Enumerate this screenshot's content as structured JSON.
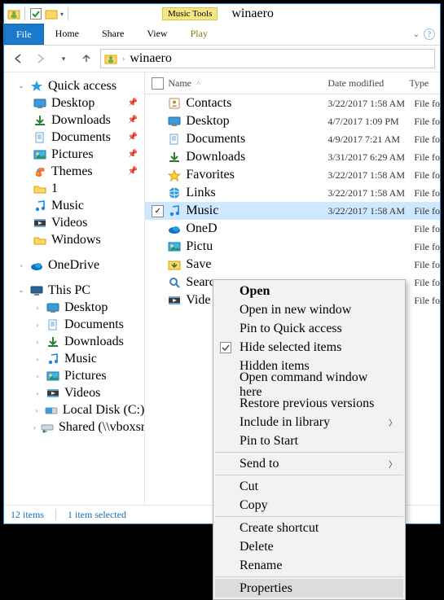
{
  "title": "winaero",
  "tools_tab": "Music Tools",
  "ribbon": {
    "file": "File",
    "tabs": [
      "Home",
      "Share",
      "View",
      "Play"
    ]
  },
  "address": {
    "segments": [
      "winaero"
    ]
  },
  "sidebar": {
    "quick_access": {
      "label": "Quick access",
      "items": [
        {
          "icon": "desktop",
          "label": "Desktop",
          "pinned": true
        },
        {
          "icon": "downloads",
          "label": "Downloads",
          "pinned": true
        },
        {
          "icon": "documents",
          "label": "Documents",
          "pinned": true
        },
        {
          "icon": "pictures",
          "label": "Pictures",
          "pinned": true
        },
        {
          "icon": "themes",
          "label": "Themes",
          "pinned": true
        },
        {
          "icon": "folder",
          "label": "1",
          "pinned": false
        },
        {
          "icon": "music",
          "label": "Music",
          "pinned": false
        },
        {
          "icon": "videos",
          "label": "Videos",
          "pinned": false
        },
        {
          "icon": "folder",
          "label": "Windows",
          "pinned": false
        }
      ]
    },
    "onedrive": {
      "label": "OneDrive"
    },
    "this_pc": {
      "label": "This PC",
      "items": [
        {
          "icon": "desktop",
          "label": "Desktop"
        },
        {
          "icon": "documents",
          "label": "Documents"
        },
        {
          "icon": "downloads",
          "label": "Downloads"
        },
        {
          "icon": "music",
          "label": "Music"
        },
        {
          "icon": "pictures",
          "label": "Pictures"
        },
        {
          "icon": "videos",
          "label": "Videos"
        },
        {
          "icon": "disk",
          "label": "Local Disk (C:)"
        },
        {
          "icon": "netdisk",
          "label": "Shared (\\\\vboxsr"
        }
      ]
    }
  },
  "columns": {
    "name": "Name",
    "date": "Date modified",
    "type": "Type"
  },
  "rows": [
    {
      "icon": "contacts",
      "name": "Contacts",
      "date": "3/22/2017 1:58 AM",
      "type": "File fo",
      "selected": false
    },
    {
      "icon": "desktop",
      "name": "Desktop",
      "date": "4/7/2017 1:09 PM",
      "type": "File fo",
      "selected": false
    },
    {
      "icon": "documents",
      "name": "Documents",
      "date": "4/9/2017 7:21 AM",
      "type": "File fo",
      "selected": false
    },
    {
      "icon": "downloads",
      "name": "Downloads",
      "date": "3/31/2017 6:29 AM",
      "type": "File fo",
      "selected": false
    },
    {
      "icon": "favorites",
      "name": "Favorites",
      "date": "3/22/2017 1:58 AM",
      "type": "File fo",
      "selected": false
    },
    {
      "icon": "links",
      "name": "Links",
      "date": "3/22/2017 1:58 AM",
      "type": "File fo",
      "selected": false
    },
    {
      "icon": "music",
      "name": "Music",
      "date": "3/22/2017 1:58 AM",
      "type": "File fo",
      "selected": true
    },
    {
      "icon": "onedrive",
      "name": "OneD",
      "date": "",
      "type": "File fo",
      "selected": false
    },
    {
      "icon": "pictures",
      "name": "Pictu",
      "date": "",
      "type": "File fo",
      "selected": false
    },
    {
      "icon": "saved",
      "name": "Save",
      "date": "",
      "type": "File fo",
      "selected": false
    },
    {
      "icon": "search",
      "name": "Searc",
      "date": "",
      "type": "File fo",
      "selected": false
    },
    {
      "icon": "videos",
      "name": "Vide",
      "date": "",
      "type": "File fo",
      "selected": false
    }
  ],
  "context_menu": {
    "groups": [
      [
        {
          "label": "Open",
          "bold": true
        },
        {
          "label": "Open in new window"
        },
        {
          "label": "Pin to Quick access"
        },
        {
          "label": "Hide selected items",
          "icon": "checkbox"
        },
        {
          "label": "Hidden items"
        },
        {
          "label": "Open command window here"
        },
        {
          "label": "Restore previous versions"
        },
        {
          "label": "Include in library",
          "submenu": true
        },
        {
          "label": "Pin to Start"
        }
      ],
      [
        {
          "label": "Send to",
          "submenu": true
        }
      ],
      [
        {
          "label": "Cut"
        },
        {
          "label": "Copy"
        }
      ],
      [
        {
          "label": "Create shortcut"
        },
        {
          "label": "Delete"
        },
        {
          "label": "Rename"
        }
      ],
      [
        {
          "label": "Properties",
          "hover": true
        }
      ]
    ]
  },
  "status": {
    "count": "12 items",
    "selection": "1 item selected"
  },
  "colors": {
    "accent": "#1979ca",
    "selection": "#cde8ff"
  }
}
